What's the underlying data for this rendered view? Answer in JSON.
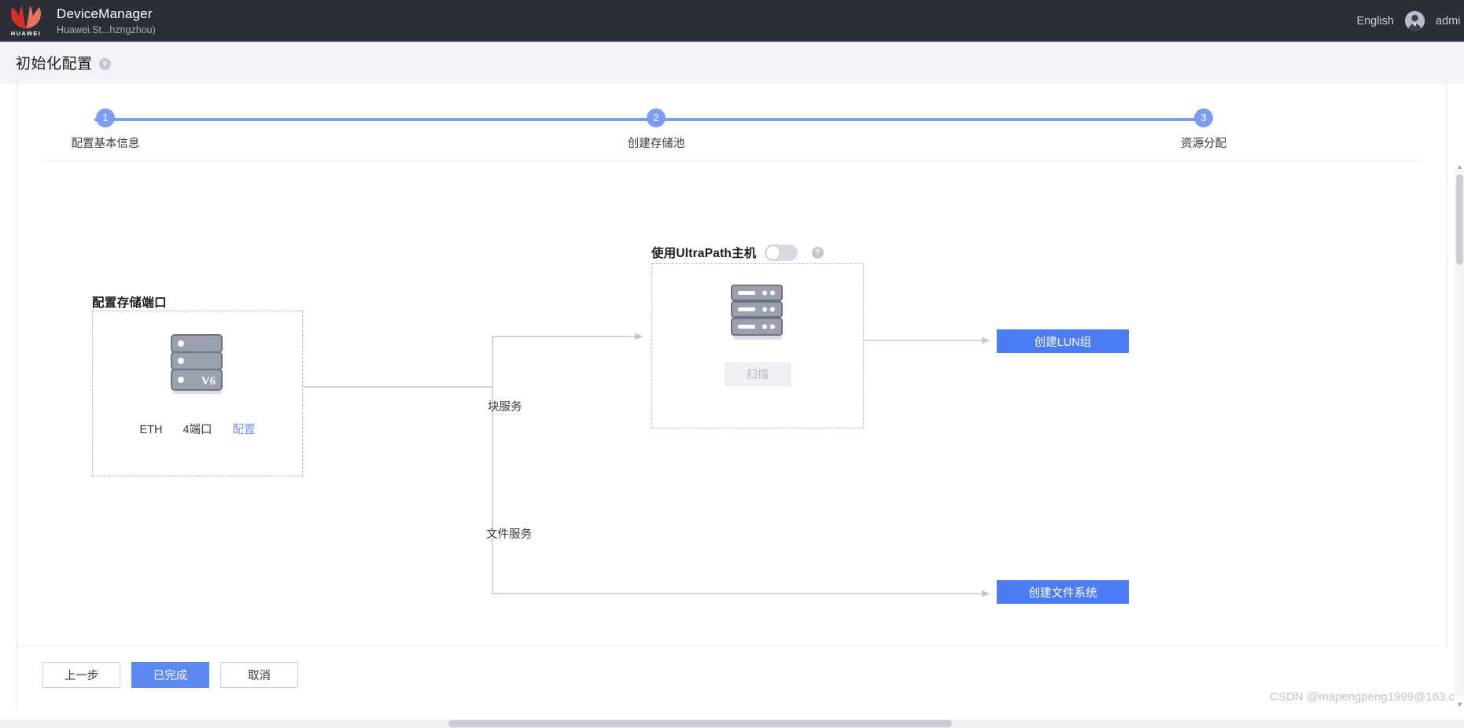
{
  "header": {
    "logo_word": "HUAWEI",
    "app_title": "DeviceManager",
    "app_subtitle": "Huawei.St...hzngzhou)",
    "language": "English",
    "user": "admi"
  },
  "page": {
    "title": "初始化配置",
    "help_glyph": "?"
  },
  "stepper": {
    "steps": [
      {
        "number": "1",
        "label": "配置基本信息"
      },
      {
        "number": "2",
        "label": "创建存储池"
      },
      {
        "number": "3",
        "label": "资源分配"
      }
    ],
    "active_color": "#7b9cf5"
  },
  "diagram": {
    "storage_port": {
      "title": "配置存储端口",
      "device_badge": "V6",
      "port_type": "ETH",
      "port_count": "4端口",
      "config_link": "配置"
    },
    "branches": {
      "block": "块服务",
      "file": "文件服务"
    },
    "ultrapath": {
      "title": "使用UltraPath主机",
      "toggle_state": "off",
      "help_glyph": "?",
      "scan_button": "扫描",
      "scan_disabled": true
    },
    "actions": {
      "create_lun_group": "创建LUN组",
      "create_file_system": "创建文件系统",
      "accent_color": "#4b7bf5"
    }
  },
  "footer": {
    "previous": "上一步",
    "finish": "已完成",
    "cancel": "取消"
  },
  "watermark": "CSDN @mapengpeng1999@163.c"
}
